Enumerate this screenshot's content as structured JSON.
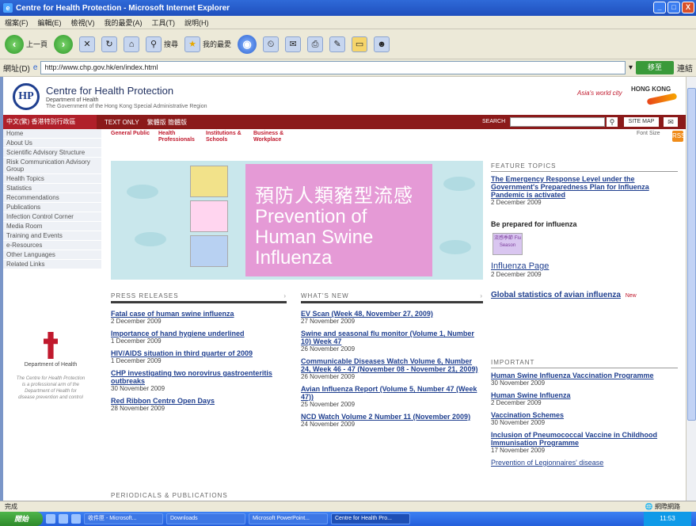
{
  "window": {
    "title": "Centre for Health Protection - Microsoft Internet Explorer",
    "controls": [
      "_",
      "□",
      "X"
    ]
  },
  "menu": [
    "檔案(F)",
    "編輯(E)",
    "檢視(V)",
    "我的最愛(A)",
    "工具(T)",
    "說明(H)"
  ],
  "toolbar": {
    "back_label": "上一頁",
    "search_label": "搜尋",
    "favorites_label": "我的最愛"
  },
  "address": {
    "label": "網址(D)",
    "url": "http://www.chp.gov.hk/en/index.html",
    "go_label": "移至",
    "links_label": "連結"
  },
  "site": {
    "logo_text": "HP",
    "title": "Centre for Health Protection",
    "dept": "Department of Health",
    "gov_line": "The Government of the Hong Kong Special Administrative Region",
    "brand_slogan": "Asia's world city",
    "hk_brand": "HONG KONG",
    "lang_label": "中文(繁) 香港特別行政區",
    "text_only": "TEXT ONLY",
    "text_zh": "繁體版  簡體版",
    "search_label": "SEARCH",
    "search_icon": "search-icon",
    "sitemap_label": "SITE MAP",
    "mail_icon": "mail-icon"
  },
  "sidebar": {
    "items": [
      "Home",
      "About Us",
      "Scientific Advisory Structure",
      "Risk Communication Advisory Group",
      "Health Topics",
      "Statistics",
      "Recommendations",
      "Publications",
      "Infection Control Corner",
      "Media Room",
      "Training and Events",
      "e-Resources",
      "Other Languages",
      "Related Links"
    ],
    "dept_label": "Department of Health",
    "dept_desc": "The Centre for Health Protection is a professional arm of the Department of Health for disease prevention and control"
  },
  "audience": [
    "General Public",
    "Health Professionals",
    "Institutions & Schools",
    "Business & Workplace"
  ],
  "page_tools": "Font Size",
  "rss_label": "RSS",
  "banner": {
    "title_zh": "預防人類豬型流感",
    "title_en": "Prevention of Human Swine Influenza"
  },
  "press": {
    "heading": "PRESS RELEASES",
    "items": [
      {
        "title": "Fatal case of human swine influenza",
        "date": "2 December 2009"
      },
      {
        "title": "Importance of hand hygiene underlined",
        "date": "1 December 2009"
      },
      {
        "title": "HIV/AIDS situation in third quarter of 2009",
        "date": "1 December 2009"
      },
      {
        "title": "CHP investigating two norovirus gastroenteritis outbreaks",
        "date": "30 November 2009"
      },
      {
        "title": "Red Ribbon Centre Open Days",
        "date": "28 November 2009"
      }
    ]
  },
  "whatsnew": {
    "heading": "WHAT'S NEW",
    "items": [
      {
        "title": "EV Scan (Week 48, November 27, 2009)",
        "date": "27 November 2009"
      },
      {
        "title": "Swine and seasonal flu monitor (Volume 1, Number 10) Week 47",
        "date": "26 November 2009"
      },
      {
        "title": "Communicable Diseases Watch Volume 6, Number 24, Week 46 - 47 (November 08 - November 21, 2009)",
        "date": "26 November 2009"
      },
      {
        "title": "Avian Influenza Report (Volume 5, Number 47 (Week 47))",
        "date": "25 November 2009"
      },
      {
        "title": "NCD Watch Volume 2 Number 11 (November 2009)",
        "date": "24 November 2009"
      }
    ]
  },
  "periodicals_heading": "PERIODICALS & PUBLICATIONS",
  "feature": {
    "heading": "FEATURE TOPICS",
    "main_title": "The Emergency Response Level under the Government's Preparedness Plan for Influenza Pandemic is activated",
    "main_date": "2 December 2009",
    "prepared": "Be prepared for influenza",
    "thumb_text": "流感季節 Flu Season",
    "flu_page": "Influenza Page",
    "flu_page_date": "2 December 2009",
    "global_stats": "Global statistics of avian influenza",
    "new_badge": "New"
  },
  "important": {
    "heading": "IMPORTANT",
    "items": [
      {
        "title": "Human Swine Influenza Vaccination Programme",
        "date": "30 November 2009"
      },
      {
        "title": "Human Swine Influenza",
        "date": "2 December 2009"
      },
      {
        "title": "Vaccination Schemes",
        "date": "30 November 2009"
      },
      {
        "title": "Inclusion of Pneumococcal Vaccine in Childhood Immunisation Programme",
        "date": "17 November 2009"
      },
      {
        "title": "Prevention of Legionnaires' disease",
        "date": ""
      }
    ]
  },
  "status": {
    "text": "完成",
    "zone": "網際網路"
  },
  "taskbar": {
    "start": "開始",
    "tasks": [
      "收件匣 - Microsoft...",
      "Downloads",
      "Microsoft PowerPoint...",
      "Centre for Health Pro..."
    ],
    "clock": "11:53"
  }
}
